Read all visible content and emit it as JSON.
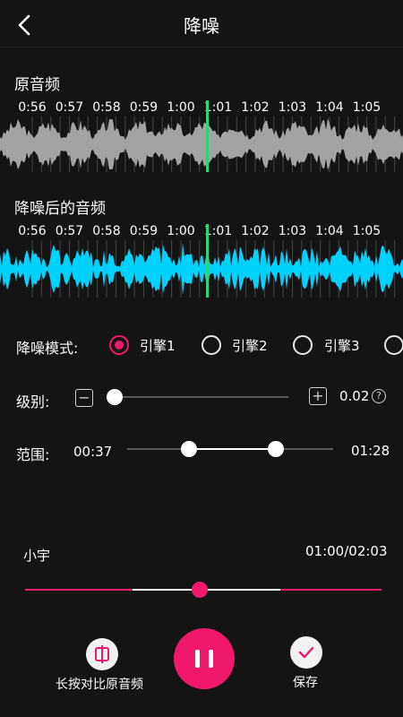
{
  "header": {
    "title": "降噪"
  },
  "original": {
    "title": "原音频",
    "ticks": [
      "0:56",
      "0:57",
      "0:58",
      "0:59",
      "1:00",
      "1:01",
      "1:02",
      "1:03",
      "1:04",
      "1:05"
    ],
    "color": "#a3a3a3"
  },
  "denoised": {
    "title": "降噪后的音频",
    "ticks": [
      "0:56",
      "0:57",
      "0:58",
      "0:59",
      "1:00",
      "1:01",
      "1:02",
      "1:03",
      "1:04",
      "1:05"
    ],
    "color": "#00d2ff"
  },
  "playhead_color": "#2ed37a",
  "mode": {
    "label": "降噪模式:",
    "options": [
      "引擎1",
      "引擎2",
      "引擎3"
    ],
    "selected": 0
  },
  "level": {
    "label": "级别:",
    "minus": "−",
    "plus": "+",
    "value": "0.02",
    "help": "?",
    "fraction": 0.0
  },
  "range": {
    "label": "范围:",
    "start": "00:37",
    "end": "01:28"
  },
  "player": {
    "track_name": "小宇",
    "time": "01:00/02:03",
    "progress": 0.49
  },
  "bottom": {
    "compare_label": "长按对比原音频",
    "save_label": "保存"
  },
  "colors": {
    "accent": "#f0186a",
    "background": "#141414"
  }
}
